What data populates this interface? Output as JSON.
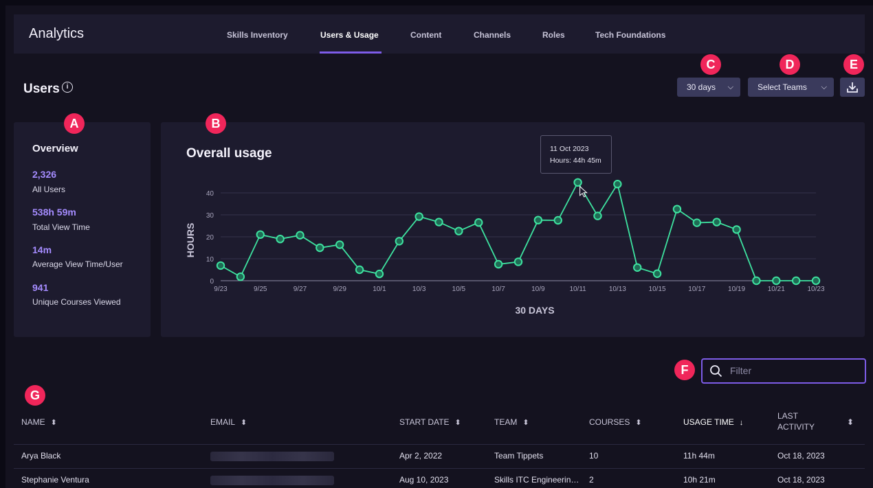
{
  "header": {
    "app_title": "Analytics",
    "tabs": [
      {
        "label": "Skills Inventory"
      },
      {
        "label": "Users & Usage",
        "active": true
      },
      {
        "label": "Content"
      },
      {
        "label": "Channels"
      },
      {
        "label": "Roles"
      },
      {
        "label": "Tech Foundations"
      }
    ]
  },
  "page": {
    "title": "Users",
    "info_icon": "info-icon"
  },
  "controls": {
    "range_dropdown": "30 days",
    "teams_dropdown": "Select Teams",
    "download_icon": "download-icon"
  },
  "badges": {
    "a": "A",
    "b": "B",
    "c": "C",
    "d": "D",
    "e": "E",
    "f": "F",
    "g": "G"
  },
  "overview": {
    "title": "Overview",
    "stats": [
      {
        "value": "2,326",
        "label": "All Users"
      },
      {
        "value": "538h 59m",
        "label": "Total View Time"
      },
      {
        "value": "14m",
        "label": "Average View Time/User"
      },
      {
        "value": "941",
        "label": "Unique Courses Viewed"
      }
    ]
  },
  "chart_data": {
    "type": "line",
    "title": "Overall usage",
    "xlabel": "30 DAYS",
    "ylabel": "HOURS",
    "ylim": [
      0,
      50
    ],
    "yticks": [
      0,
      10,
      20,
      30,
      40
    ],
    "x_tick_labels": [
      "9/23",
      "9/25",
      "9/27",
      "9/29",
      "10/1",
      "10/3",
      "10/5",
      "10/7",
      "10/9",
      "10/11",
      "10/13",
      "10/15",
      "10/17",
      "10/19",
      "10/21",
      "10/23"
    ],
    "x": [
      "9/23",
      "9/24",
      "9/25",
      "9/26",
      "9/27",
      "9/28",
      "9/29",
      "9/30",
      "10/1",
      "10/2",
      "10/3",
      "10/4",
      "10/5",
      "10/6",
      "10/7",
      "10/8",
      "10/9",
      "10/10",
      "10/11",
      "10/12",
      "10/13",
      "10/14",
      "10/15",
      "10/16",
      "10/17",
      "10/18",
      "10/19",
      "10/20",
      "10/21",
      "10/22",
      "10/23"
    ],
    "values": [
      6.9,
      1.8,
      21,
      19,
      20.7,
      15,
      16.4,
      5,
      3.1,
      18,
      29.2,
      26.7,
      22.6,
      26.5,
      7.5,
      8.6,
      27.6,
      27.5,
      44.75,
      29.5,
      44,
      6,
      3.2,
      32.6,
      26.4,
      26.7,
      23.3,
      0,
      0,
      0,
      0
    ],
    "grid": true,
    "color": "#3ee3a0",
    "tooltip": {
      "date": "11 Oct 2023",
      "text": "Hours: 44h 45m"
    }
  },
  "filter": {
    "placeholder": "Filter",
    "value": ""
  },
  "table": {
    "columns": [
      {
        "label": "NAME"
      },
      {
        "label": "EMAIL"
      },
      {
        "label": "START DATE"
      },
      {
        "label": "TEAM"
      },
      {
        "label": "COURSES"
      },
      {
        "label": "USAGE TIME",
        "active": true
      },
      {
        "label": "LAST\nACTIVITY"
      }
    ],
    "rows": [
      {
        "name": "Arya Black",
        "start": "Apr 2, 2022",
        "team": "Team Tippets",
        "courses": "10",
        "usage": "11h 44m",
        "last": "Oct 18, 2023"
      },
      {
        "name": "Stephanie Ventura",
        "start": "Aug 10, 2023",
        "team": "Skills ITC Engineerin…",
        "courses": "2",
        "usage": "10h 21m",
        "last": "Oct 18, 2023"
      }
    ]
  }
}
